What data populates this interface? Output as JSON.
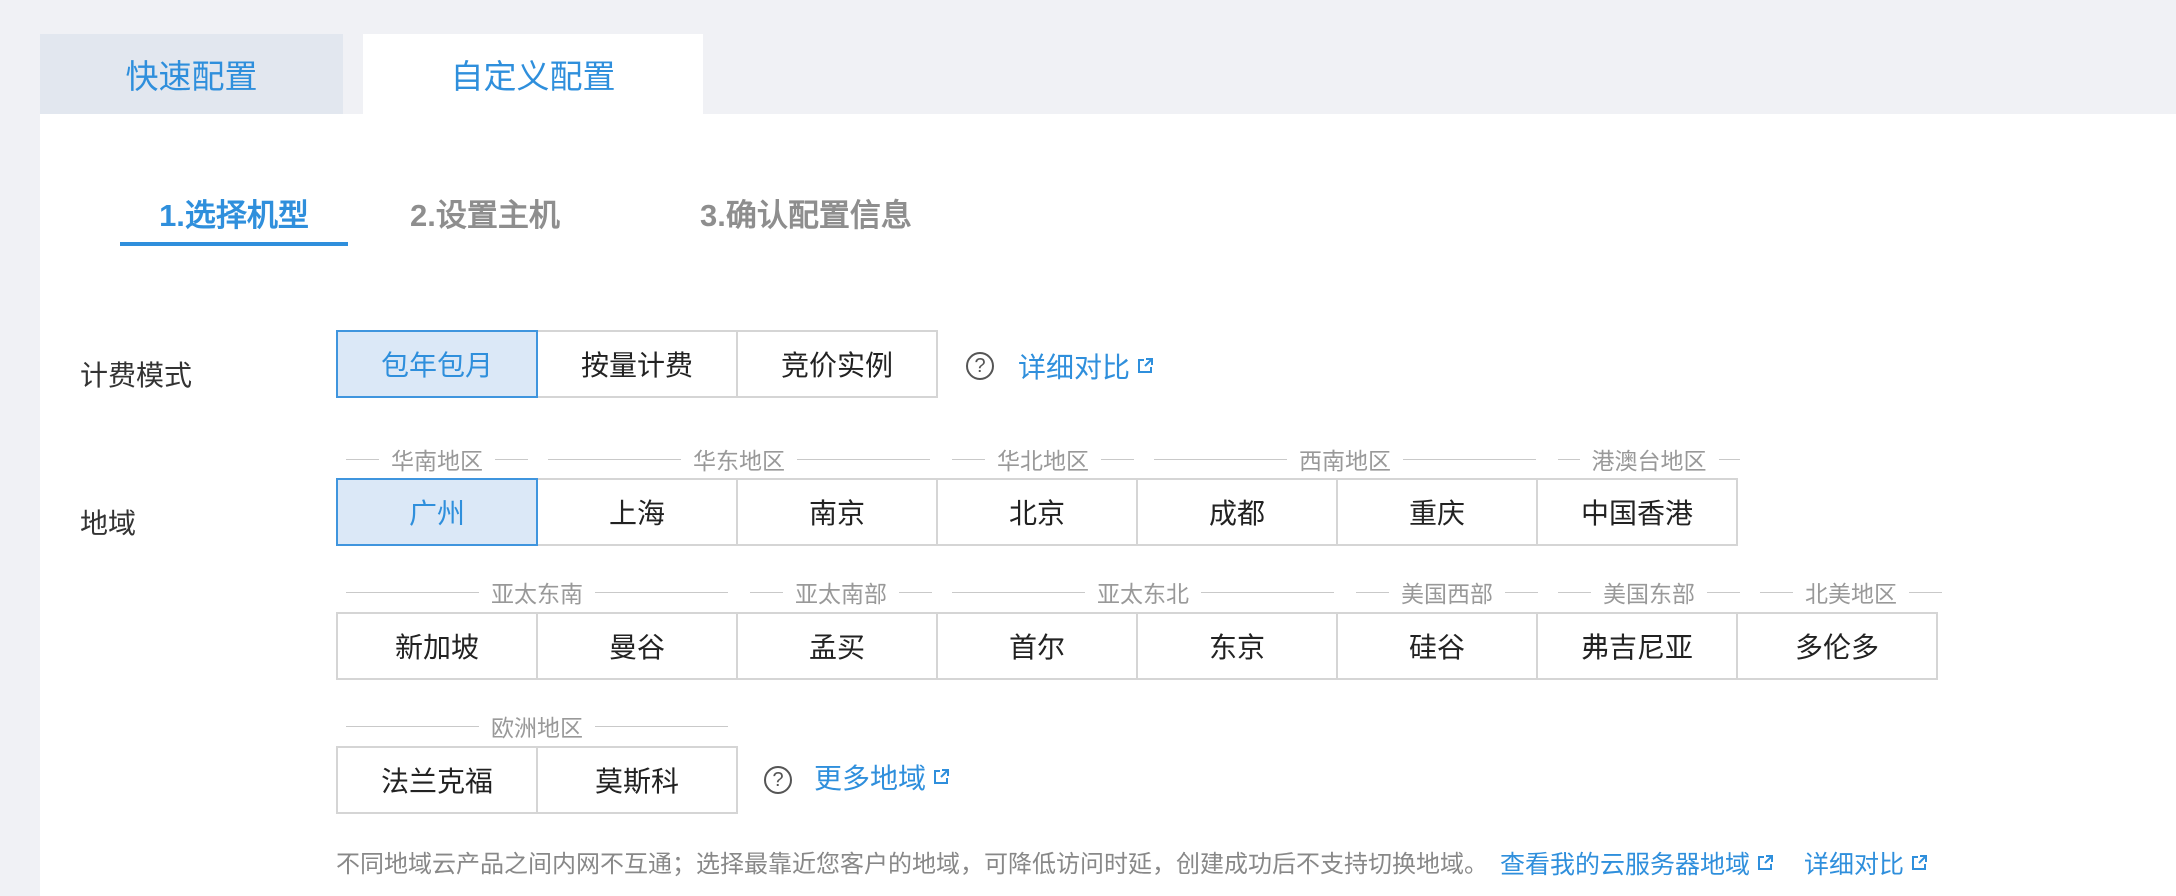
{
  "mode_tabs": {
    "quick": "快速配置",
    "custom": "自定义配置"
  },
  "steps": [
    "1.选择机型",
    "2.设置主机",
    "3.确认配置信息"
  ],
  "billing": {
    "label": "计费模式",
    "options": [
      "包年包月",
      "按量计费",
      "竞价实例"
    ],
    "selected": "包年包月",
    "link": "详细对比"
  },
  "region": {
    "label": "地域",
    "row1": {
      "groups": [
        "华南地区",
        "华东地区",
        "华北地区",
        "西南地区",
        "港澳台地区"
      ],
      "cities": [
        "广州",
        "上海",
        "南京",
        "北京",
        "成都",
        "重庆",
        "中国香港"
      ]
    },
    "row2": {
      "groups": [
        "亚太东南",
        "亚太南部",
        "亚太东北",
        "美国西部",
        "美国东部",
        "北美地区"
      ],
      "cities": [
        "新加坡",
        "曼谷",
        "孟买",
        "首尔",
        "东京",
        "硅谷",
        "弗吉尼亚",
        "多伦多"
      ]
    },
    "row3": {
      "groups": [
        "欧洲地区"
      ],
      "cities": [
        "法兰克福",
        "莫斯科"
      ]
    },
    "selected": "广州",
    "more_link": "更多地域",
    "note": "不同地域云产品之间内网不互通；选择最靠近您客户的地域，可降低访问时延，创建成功后不支持切换地域。",
    "my_regions_link": "查看我的云服务器地域",
    "compare_link": "详细对比"
  },
  "icons": {
    "help": "question-circle-icon",
    "external": "external-link-icon"
  },
  "colors": {
    "accent": "#2f8fdc",
    "active_bg": "#dbe8f7"
  }
}
